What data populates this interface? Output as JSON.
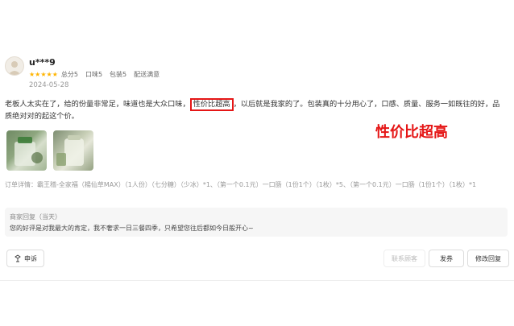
{
  "review": {
    "username": "u***9",
    "rating": 5,
    "ratings": [
      "总分5",
      "口味5",
      "包装5",
      "配送满意"
    ],
    "date": "2024-05-28",
    "text_before": "老板人太实在了，给的份量非常足，味道也是大众口味，",
    "text_highlight": "性价比超高",
    "text_after": "，以后就是我家的了。包装真的十分用心了，口感、质量、服务一如既往的好，品质绝对对的起这个价。",
    "annotation": "性价比超高",
    "photos": [
      "photo-1",
      "photo-2"
    ],
    "order_detail": "订单详情：霸王稽-全家福（楊仙草MAX）（1人份）（七分糖）（少冰）*1、（第一个0.1元）一口肠（1份1个）（1枚）*5、（第一个0.1元）一口肠（1份1个）（1枚）*1"
  },
  "merchant_reply": {
    "title": "商家回复（当天）",
    "text": "您的好评是对我最大的肯定，我不奢求一日三餐四季，只希望您往后都如今日般开心~"
  },
  "actions": {
    "appeal": "申诉",
    "contact": "联系顾客",
    "coupon": "发券",
    "edit_reply": "修改回复"
  },
  "colors": {
    "star": "#ffb400",
    "highlight": "#e51616"
  }
}
